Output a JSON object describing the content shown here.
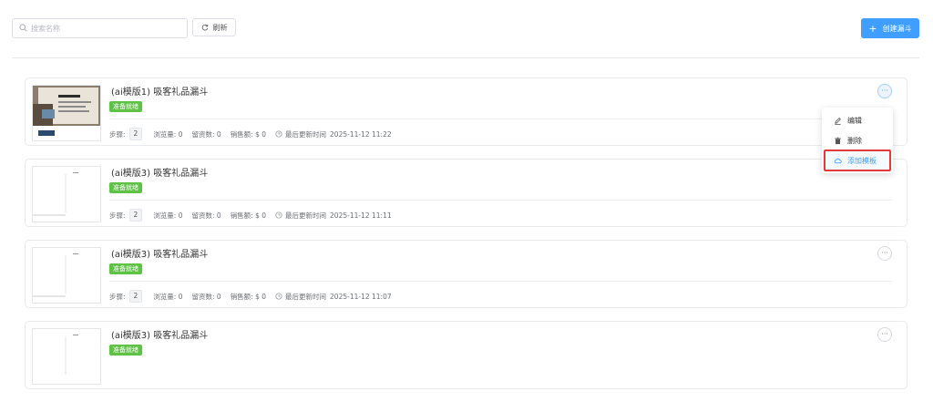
{
  "toolbar": {
    "search_placeholder": "搜索名称",
    "refresh_label": "刷新",
    "create_label": "创建漏斗",
    "accent_color": "#409eff"
  },
  "stats_labels": {
    "steps": "步骤:",
    "views": "浏览量: 0",
    "leads": "留资数: 0",
    "sales": "销售额: $ 0",
    "updated_prefix": "最后更新时间"
  },
  "funnels": [
    {
      "title": "(ai模版1) 吸客礼品漏斗",
      "status": "准备就绪",
      "steps": "2",
      "updated": "2025-11-12 11:22",
      "thumbnail": "image-template-icon",
      "menu_open": true
    },
    {
      "title": "(ai模版3) 吸客礼品漏斗",
      "status": "准备就绪",
      "steps": "2",
      "updated": "2025-11-12 11:11",
      "thumbnail": "blank-page-icon",
      "menu_open": false
    },
    {
      "title": "(ai模版3) 吸客礼品漏斗",
      "status": "准备就绪",
      "steps": "2",
      "updated": "2025-11-12 11:07",
      "thumbnail": "blank-page-icon",
      "menu_open": false
    },
    {
      "title": "(ai模版3) 吸客礼品漏斗",
      "status": "准备就绪",
      "steps": "",
      "updated": "",
      "thumbnail": "blank-page-icon",
      "menu_open": false
    }
  ],
  "dropdown_menu": {
    "items": [
      {
        "label": "编辑",
        "icon": "edit-icon"
      },
      {
        "label": "删除",
        "icon": "trash-icon"
      },
      {
        "label": "添加模板",
        "icon": "cloud-icon",
        "highlighted": true
      }
    ]
  },
  "status_color": "#5ec245",
  "highlight_color": "#e23b3b"
}
